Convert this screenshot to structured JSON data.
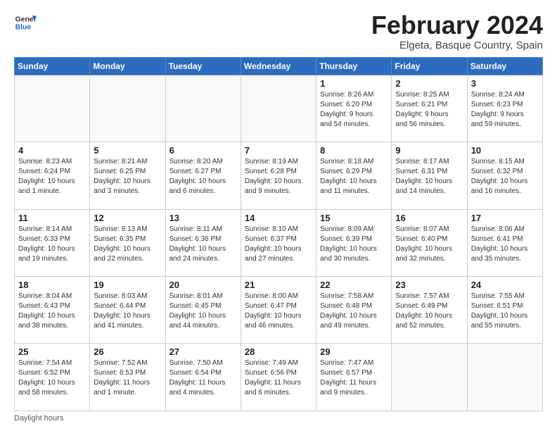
{
  "header": {
    "logo_general": "General",
    "logo_blue": "Blue",
    "month_title": "February 2024",
    "location": "Elgeta, Basque Country, Spain"
  },
  "days_of_week": [
    "Sunday",
    "Monday",
    "Tuesday",
    "Wednesday",
    "Thursday",
    "Friday",
    "Saturday"
  ],
  "weeks": [
    [
      {
        "day": "",
        "info": ""
      },
      {
        "day": "",
        "info": ""
      },
      {
        "day": "",
        "info": ""
      },
      {
        "day": "",
        "info": ""
      },
      {
        "day": "1",
        "info": "Sunrise: 8:26 AM\nSunset: 6:20 PM\nDaylight: 9 hours\nand 54 minutes."
      },
      {
        "day": "2",
        "info": "Sunrise: 8:25 AM\nSunset: 6:21 PM\nDaylight: 9 hours\nand 56 minutes."
      },
      {
        "day": "3",
        "info": "Sunrise: 8:24 AM\nSunset: 6:23 PM\nDaylight: 9 hours\nand 59 minutes."
      }
    ],
    [
      {
        "day": "4",
        "info": "Sunrise: 8:23 AM\nSunset: 6:24 PM\nDaylight: 10 hours\nand 1 minute."
      },
      {
        "day": "5",
        "info": "Sunrise: 8:21 AM\nSunset: 6:25 PM\nDaylight: 10 hours\nand 3 minutes."
      },
      {
        "day": "6",
        "info": "Sunrise: 8:20 AM\nSunset: 6:27 PM\nDaylight: 10 hours\nand 6 minutes."
      },
      {
        "day": "7",
        "info": "Sunrise: 8:19 AM\nSunset: 6:28 PM\nDaylight: 10 hours\nand 9 minutes."
      },
      {
        "day": "8",
        "info": "Sunrise: 8:18 AM\nSunset: 6:29 PM\nDaylight: 10 hours\nand 11 minutes."
      },
      {
        "day": "9",
        "info": "Sunrise: 8:17 AM\nSunset: 6:31 PM\nDaylight: 10 hours\nand 14 minutes."
      },
      {
        "day": "10",
        "info": "Sunrise: 8:15 AM\nSunset: 6:32 PM\nDaylight: 10 hours\nand 16 minutes."
      }
    ],
    [
      {
        "day": "11",
        "info": "Sunrise: 8:14 AM\nSunset: 6:33 PM\nDaylight: 10 hours\nand 19 minutes."
      },
      {
        "day": "12",
        "info": "Sunrise: 8:13 AM\nSunset: 6:35 PM\nDaylight: 10 hours\nand 22 minutes."
      },
      {
        "day": "13",
        "info": "Sunrise: 8:11 AM\nSunset: 6:36 PM\nDaylight: 10 hours\nand 24 minutes."
      },
      {
        "day": "14",
        "info": "Sunrise: 8:10 AM\nSunset: 6:37 PM\nDaylight: 10 hours\nand 27 minutes."
      },
      {
        "day": "15",
        "info": "Sunrise: 8:09 AM\nSunset: 6:39 PM\nDaylight: 10 hours\nand 30 minutes."
      },
      {
        "day": "16",
        "info": "Sunrise: 8:07 AM\nSunset: 6:40 PM\nDaylight: 10 hours\nand 32 minutes."
      },
      {
        "day": "17",
        "info": "Sunrise: 8:06 AM\nSunset: 6:41 PM\nDaylight: 10 hours\nand 35 minutes."
      }
    ],
    [
      {
        "day": "18",
        "info": "Sunrise: 8:04 AM\nSunset: 6:43 PM\nDaylight: 10 hours\nand 38 minutes."
      },
      {
        "day": "19",
        "info": "Sunrise: 8:03 AM\nSunset: 6:44 PM\nDaylight: 10 hours\nand 41 minutes."
      },
      {
        "day": "20",
        "info": "Sunrise: 8:01 AM\nSunset: 6:45 PM\nDaylight: 10 hours\nand 44 minutes."
      },
      {
        "day": "21",
        "info": "Sunrise: 8:00 AM\nSunset: 6:47 PM\nDaylight: 10 hours\nand 46 minutes."
      },
      {
        "day": "22",
        "info": "Sunrise: 7:58 AM\nSunset: 6:48 PM\nDaylight: 10 hours\nand 49 minutes."
      },
      {
        "day": "23",
        "info": "Sunrise: 7:57 AM\nSunset: 6:49 PM\nDaylight: 10 hours\nand 52 minutes."
      },
      {
        "day": "24",
        "info": "Sunrise: 7:55 AM\nSunset: 6:51 PM\nDaylight: 10 hours\nand 55 minutes."
      }
    ],
    [
      {
        "day": "25",
        "info": "Sunrise: 7:54 AM\nSunset: 6:52 PM\nDaylight: 10 hours\nand 58 minutes."
      },
      {
        "day": "26",
        "info": "Sunrise: 7:52 AM\nSunset: 6:53 PM\nDaylight: 11 hours\nand 1 minute."
      },
      {
        "day": "27",
        "info": "Sunrise: 7:50 AM\nSunset: 6:54 PM\nDaylight: 11 hours\nand 4 minutes."
      },
      {
        "day": "28",
        "info": "Sunrise: 7:49 AM\nSunset: 6:56 PM\nDaylight: 11 hours\nand 6 minutes."
      },
      {
        "day": "29",
        "info": "Sunrise: 7:47 AM\nSunset: 6:57 PM\nDaylight: 11 hours\nand 9 minutes."
      },
      {
        "day": "",
        "info": ""
      },
      {
        "day": "",
        "info": ""
      }
    ]
  ],
  "footer": {
    "daylight_label": "Daylight hours"
  }
}
